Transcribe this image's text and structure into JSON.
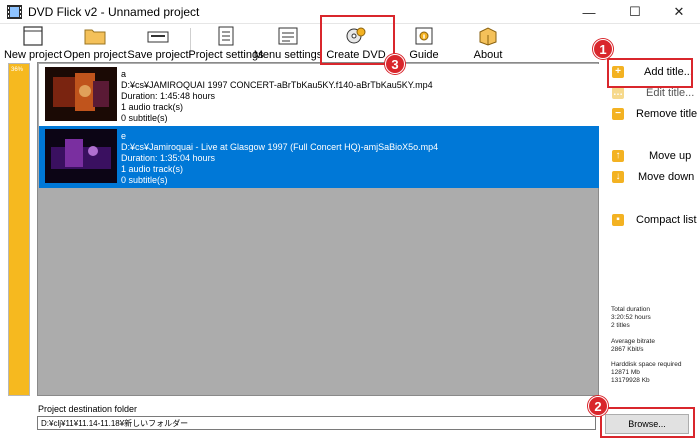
{
  "window": {
    "title": "DVD Flick v2 - Unnamed project",
    "minimize": "—",
    "maximize": "☐",
    "close": "✕"
  },
  "toolbar": {
    "new_project": "New project",
    "open_project": "Open project",
    "save_project": "Save project",
    "project_settings": "Project settings",
    "menu_settings": "Menu settings",
    "create_dvd": "Create DVD",
    "guide": "Guide",
    "about": "About"
  },
  "progress": {
    "label": "36%",
    "value": 0.36
  },
  "titles": [
    {
      "name": "a",
      "path": "D:¥cs¥JAMIROQUAI 1997 CONCERT-aBrTbKau5KY.f140-aBrTbKau5KY.mp4",
      "duration": "Duration: 1:45:48 hours",
      "audio": "1 audio track(s)",
      "subtitles": "0 subtitle(s)",
      "selected": false
    },
    {
      "name": "e",
      "path": "D:¥cs¥Jamiroquai - Live at Glasgow 1997 (Full Concert HQ)-amjSaBioX5o.mp4",
      "duration": "Duration: 1:35:04 hours",
      "audio": "1 audio track(s)",
      "subtitles": "0 subtitle(s)",
      "selected": true
    }
  ],
  "sidebar": {
    "add_title": "Add title...",
    "edit_title": "Edit title...",
    "remove_title": "Remove title",
    "move_up": "Move up",
    "move_down": "Move down",
    "compact_list": "Compact list"
  },
  "stats": {
    "total_duration_label": "Total duration",
    "total_duration_value": "3:20:52 hours",
    "titles_count": "2 titles",
    "avg_bitrate_label": "Average bitrate",
    "avg_bitrate_value": "2867 Kbit/s",
    "hdd_label": "Harddisk space required",
    "hdd_mb": "12871 Mb",
    "hdd_kb": "13179928 Kb"
  },
  "destination": {
    "label": "Project destination folder",
    "value": "D:¥clj¥11¥11.14-11.18¥新しいフォルダー",
    "browse": "Browse..."
  },
  "callouts": {
    "one": "1",
    "two": "2",
    "three": "3"
  },
  "colors": {
    "accent_orange": "#f6b91f",
    "selection_blue": "#0078d7",
    "callout_red": "#d9262c",
    "list_background": "#acacac"
  }
}
